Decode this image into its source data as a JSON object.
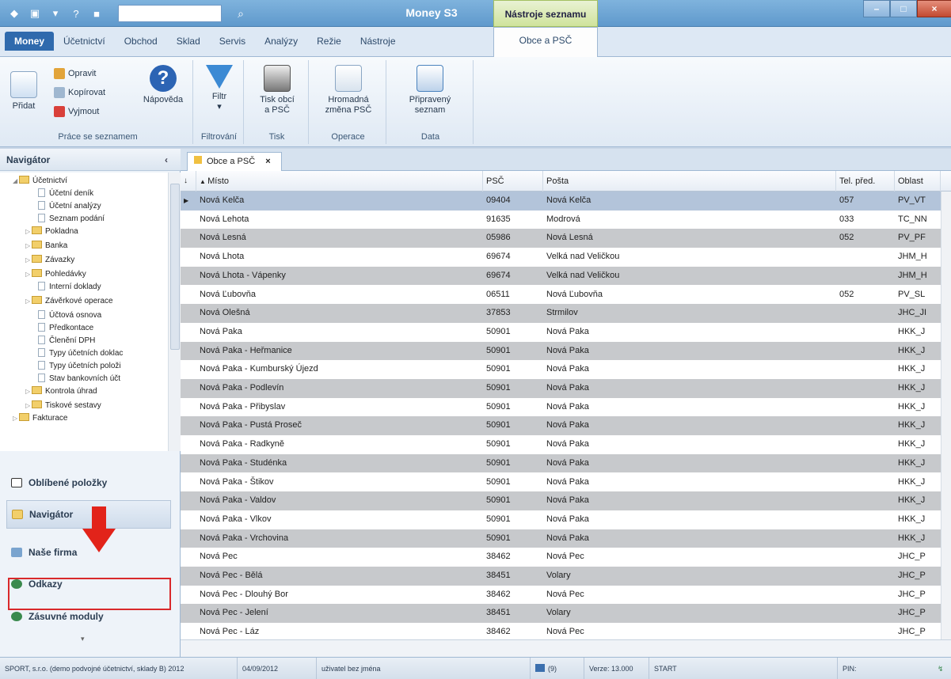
{
  "titlebar": {
    "app_title": "Money S3",
    "context_tab": "Nástroje seznamu"
  },
  "tabs": [
    "Money",
    "Účetnictví",
    "Obchod",
    "Sklad",
    "Servis",
    "Analýzy",
    "Režie",
    "Nástroje"
  ],
  "context_tab_label": "Obce a PSČ",
  "ribbon": {
    "pridat": "Přidat",
    "opravit": "Opravit",
    "kopirovat": "Kopírovat",
    "vyjmout": "Vyjmout",
    "napoveda": "Nápověda",
    "prace_label": "Práce se seznamem",
    "filtr": "Filtr",
    "filtrovani_label": "Filtrování",
    "tisk_line1": "Tisk obcí",
    "tisk_line2": "a PSČ",
    "tisk_label": "Tisk",
    "hromadna_line1": "Hromadná",
    "hromadna_line2": "změna PSČ",
    "operace_label": "Operace",
    "pripraveny_line1": "Připravený",
    "pripraveny_line2": "seznam",
    "data_label": "Data"
  },
  "navigator": {
    "title": "Navigátor",
    "collapse": "‹",
    "tree": [
      {
        "label": "Účetnictví",
        "type": "folder-open"
      },
      {
        "label": "Účetní deník",
        "type": "doc"
      },
      {
        "label": "Účetní analýzy",
        "type": "doc"
      },
      {
        "label": "Seznam podání",
        "type": "doc"
      },
      {
        "label": "Pokladna",
        "type": "folder"
      },
      {
        "label": "Banka",
        "type": "folder"
      },
      {
        "label": "Závazky",
        "type": "folder"
      },
      {
        "label": "Pohledávky",
        "type": "folder"
      },
      {
        "label": "Interní doklady",
        "type": "doc"
      },
      {
        "label": "Závěrkové operace",
        "type": "folder"
      },
      {
        "label": "Účtová osnova",
        "type": "doc"
      },
      {
        "label": "Předkontace",
        "type": "doc"
      },
      {
        "label": "Členění DPH",
        "type": "doc"
      },
      {
        "label": "Typy účetních doklac",
        "type": "doc"
      },
      {
        "label": "Typy účetních položi",
        "type": "doc"
      },
      {
        "label": "Stav bankovních účt",
        "type": "doc"
      },
      {
        "label": "Kontrola úhrad",
        "type": "folder"
      },
      {
        "label": "Tiskové sestavy",
        "type": "folder"
      },
      {
        "label": "Fakturace",
        "type": "folder"
      }
    ],
    "buttons": [
      "Oblíbené položky",
      "Navigátor",
      "Naše firma",
      "Odkazy",
      "Zásuvné moduly"
    ]
  },
  "doc_tab": {
    "label": "Obce a PSČ",
    "close": "×"
  },
  "grid": {
    "headers": [
      "Místo",
      "PSČ",
      "Pošta",
      "Tel. před.",
      "Oblast"
    ],
    "rows": [
      [
        "Nová Kelča",
        "09404",
        "Nová Kelča",
        "057",
        "PV_VT"
      ],
      [
        "Nová Lehota",
        "91635",
        "Modrová",
        "033",
        "TC_NN"
      ],
      [
        "Nová Lesná",
        "05986",
        "Nová Lesná",
        "052",
        "PV_PF"
      ],
      [
        "Nová Lhota",
        "69674",
        "Velká nad Veličkou",
        "",
        "JHM_H"
      ],
      [
        "Nová Lhota - Vápenky",
        "69674",
        "Velká nad Veličkou",
        "",
        "JHM_H"
      ],
      [
        "Nová Ľubovňa",
        "06511",
        "Nová Ľubovňa",
        "052",
        "PV_SL"
      ],
      [
        "Nová Olešná",
        "37853",
        "Strmilov",
        "",
        "JHC_JI"
      ],
      [
        "Nová Paka",
        "50901",
        "Nová Paka",
        "",
        "HKK_J"
      ],
      [
        "Nová Paka - Heřmanice",
        "50901",
        "Nová Paka",
        "",
        "HKK_J"
      ],
      [
        "Nová Paka - Kumburský Újezd",
        "50901",
        "Nová Paka",
        "",
        "HKK_J"
      ],
      [
        "Nová Paka - Podlevín",
        "50901",
        "Nová Paka",
        "",
        "HKK_J"
      ],
      [
        "Nová Paka - Přibyslav",
        "50901",
        "Nová Paka",
        "",
        "HKK_J"
      ],
      [
        "Nová Paka - Pustá Proseč",
        "50901",
        "Nová Paka",
        "",
        "HKK_J"
      ],
      [
        "Nová Paka - Radkyně",
        "50901",
        "Nová Paka",
        "",
        "HKK_J"
      ],
      [
        "Nová Paka - Studénka",
        "50901",
        "Nová Paka",
        "",
        "HKK_J"
      ],
      [
        "Nová Paka - Štikov",
        "50901",
        "Nová Paka",
        "",
        "HKK_J"
      ],
      [
        "Nová Paka - Valdov",
        "50901",
        "Nová Paka",
        "",
        "HKK_J"
      ],
      [
        "Nová Paka - Vlkov",
        "50901",
        "Nová Paka",
        "",
        "HKK_J"
      ],
      [
        "Nová Paka - Vrchovina",
        "50901",
        "Nová Paka",
        "",
        "HKK_J"
      ],
      [
        "Nová Pec",
        "38462",
        "Nová Pec",
        "",
        "JHC_P"
      ],
      [
        "Nová Pec - Bělá",
        "38451",
        "Volary",
        "",
        "JHC_P"
      ],
      [
        "Nová Pec - Dlouhý Bor",
        "38462",
        "Nová Pec",
        "",
        "JHC_P"
      ],
      [
        "Nová Pec - Jelení",
        "38451",
        "Volary",
        "",
        "JHC_P"
      ],
      [
        "Nová Pec - Láz",
        "38462",
        "Nová Pec",
        "",
        "JHC_P"
      ]
    ]
  },
  "status": {
    "firm": "SPORT, s.r.o. (demo podvojné účetnictví, sklady B) 2012",
    "date": "04/09/2012",
    "user": "uživatel bez jména",
    "count": "(9)",
    "version": "Verze: 13.000",
    "start": "START",
    "pin": "PIN:"
  }
}
